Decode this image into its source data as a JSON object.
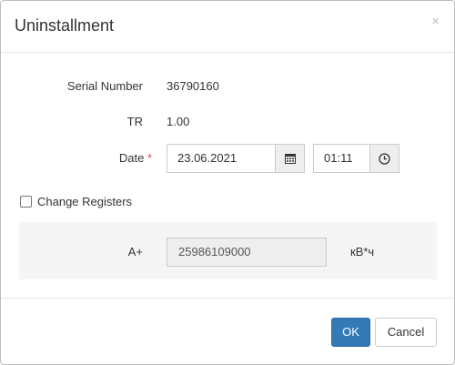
{
  "dialog": {
    "title": "Uninstallment",
    "close_glyph": "×"
  },
  "fields": {
    "serial_label": "Serial Number",
    "serial_value": "36790160",
    "tr_label": "TR",
    "tr_value": "1.00",
    "date_label": "Date",
    "required_mark": "*",
    "date_value": "23.06.2021",
    "time_value": "01:11"
  },
  "registers": {
    "checkbox_label": "Change Registers",
    "checked": false,
    "row_label": "A+",
    "row_value": "25986109000",
    "unit": "кВ*ч"
  },
  "buttons": {
    "ok": "OK",
    "cancel": "Cancel"
  },
  "icons": {
    "calendar": "calendar-icon",
    "clock": "clock-icon",
    "close": "close-icon"
  },
  "colors": {
    "primary": "#337ab7",
    "required": "#d9534f"
  }
}
